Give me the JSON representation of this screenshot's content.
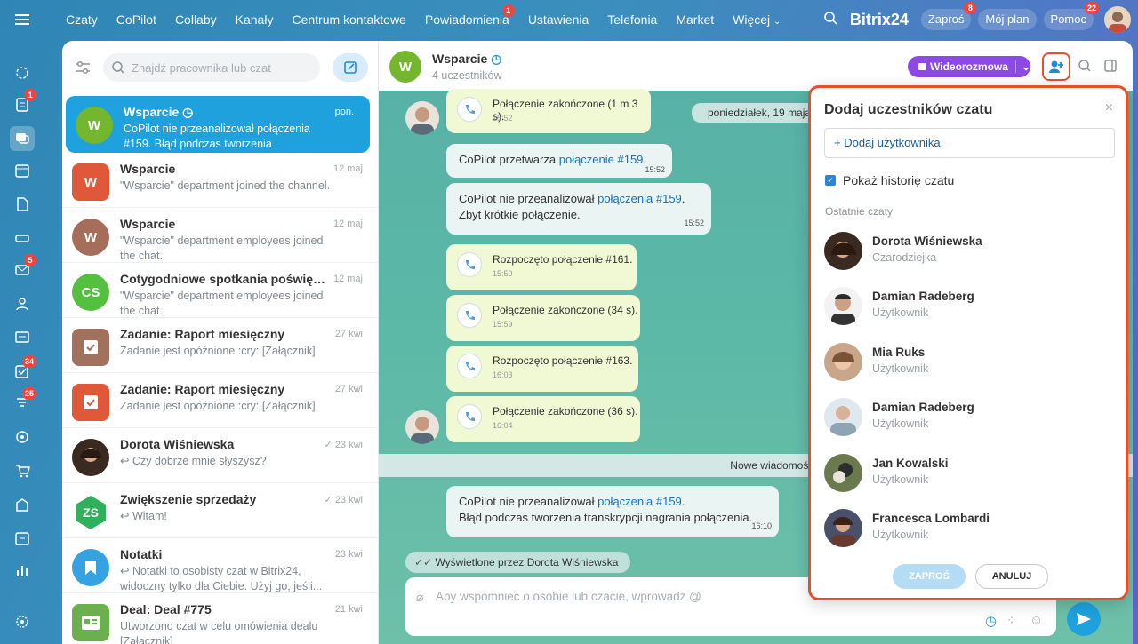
{
  "topnav": {
    "items": [
      "Czaty",
      "CoPilot",
      "Collaby",
      "Kanały",
      "Centrum kontaktowe",
      "Powiadomienia",
      "Ustawienia",
      "Telefonia",
      "Market",
      "Więcej"
    ],
    "notif_badge": "1",
    "brand": "Bitrix24",
    "invite_label": "Zaproś",
    "invite_badge": "8",
    "myplan_label": "Mój plan",
    "help_label": "Pomoc",
    "help_badge": "22"
  },
  "rail": {
    "badges": {
      "tasks": "1",
      "mail": "5",
      "todo": "34",
      "feed": "25"
    }
  },
  "list": {
    "search_placeholder": "Znajdź pracownika lub czat",
    "items": [
      {
        "title": "Wsparcie",
        "date": "pon.",
        "preview": "CoPilot nie przeanalizował połączenia #159. Błąd podczas tworzenia transkrypcji...",
        "initials": "W"
      },
      {
        "title": "Wsparcie",
        "date": "12 maj",
        "preview": "\"Wsparcie\" department joined the channel.",
        "initials": "W"
      },
      {
        "title": "Wsparcie",
        "date": "12 maj",
        "preview": "\"Wsparcie\" department employees joined the chat.",
        "initials": "W"
      },
      {
        "title": "Cotygodniowe spotkania poświęcon...",
        "date": "12 maj",
        "preview": "\"Wsparcie\" department employees joined the chat.",
        "initials": "CS"
      },
      {
        "title": "Zadanie: Raport miesięczny",
        "date": "27 kwi",
        "preview": "Zadanie jest opóźnione :cry: [Załącznik]"
      },
      {
        "title": "Zadanie: Raport miesięczny",
        "date": "27 kwi",
        "preview": "Zadanie jest opóźnione :cry: [Załącznik]"
      },
      {
        "title": "Dorota Wiśniewska",
        "date": "23 kwi",
        "preview": "↩ Czy dobrze mnie słyszysz?"
      },
      {
        "title": "Zwiększenie sprzedaży",
        "date": "23 kwi",
        "preview": "↩ Witam!",
        "initials": "ZS"
      },
      {
        "title": "Notatki",
        "date": "23 kwi",
        "preview": "↩ Notatki to osobisty czat w Bitrix24, widoczny tylko dla Ciebie. Użyj go, jeśli..."
      },
      {
        "title": "Deal: Deal #775",
        "date": "21 kwi",
        "preview": "Utworzono czat w celu omówienia dealu [Załącznik]"
      }
    ]
  },
  "chat": {
    "title": "Wsparcie",
    "initials": "W",
    "subtitle": "4 uczestników",
    "video_label": "Wideorozmowa",
    "date_chip": "poniedziałek, 19 maja",
    "messages": {
      "m1": {
        "text": "Połączenie zakończone (1 m 3 s).",
        "time": "15:52"
      },
      "m2_prefix": "CoPilot przetwarza ",
      "m2_link": "połączenie #159",
      "m2_suffix": ".",
      "m2_time": "15:52",
      "m3_prefix": "CoPilot nie przeanalizował ",
      "m3_link": "połączenia #159",
      "m3_suffix": ".",
      "m3_line2": "Zbyt krótkie połączenie.",
      "m3_time": "15:52",
      "m4": {
        "text": "Rozpoczęto połączenie #161.",
        "time": "15:59"
      },
      "m5": {
        "text": "Połączenie zakończone (34 s).",
        "time": "15:59"
      },
      "m6": {
        "text": "Rozpoczęto połączenie #163.",
        "time": "16:03"
      },
      "m7": {
        "text": "Połączenie zakończone (36 s).",
        "time": "16:04"
      },
      "m8_prefix": "CoPilot nie przeanalizował ",
      "m8_link": "połączenia #159",
      "m8_suffix": ".",
      "m8_line2": "Błąd podczas tworzenia transkrypcji nagrania połączenia.",
      "m8_time": "16:10"
    },
    "new_messages": "Nowe wiadomości",
    "seen_by": "Wyświetlone przez Dorota Wiśniewska",
    "input_placeholder": "Aby wspomnieć o osobie lub czacie, wprowadź @"
  },
  "popup": {
    "title": "Dodaj uczestników czatu",
    "add_user": "+ Dodaj użytkownika",
    "show_history": "Pokaż historię czatu",
    "recent_label": "Ostatnie czaty",
    "people": [
      {
        "name": "Dorota Wiśniewska",
        "role": "Czarodziejka"
      },
      {
        "name": "Damian Radeberg",
        "role": "Użytkownik"
      },
      {
        "name": "Mia Ruks",
        "role": "Użytkownik"
      },
      {
        "name": "Damian Radeberg",
        "role": "Użytkownik"
      },
      {
        "name": "Jan Kowalski",
        "role": "Użytkownik"
      },
      {
        "name": "Francesca Lombardi",
        "role": "Użytkownik"
      }
    ],
    "invite_btn": "ZAPROŚ",
    "cancel_btn": "ANULUJ"
  },
  "colors": {
    "accent": "#1ea1dd",
    "video": "#8d48e8",
    "highlight": "#e4502a",
    "badge": "#f4433c"
  }
}
